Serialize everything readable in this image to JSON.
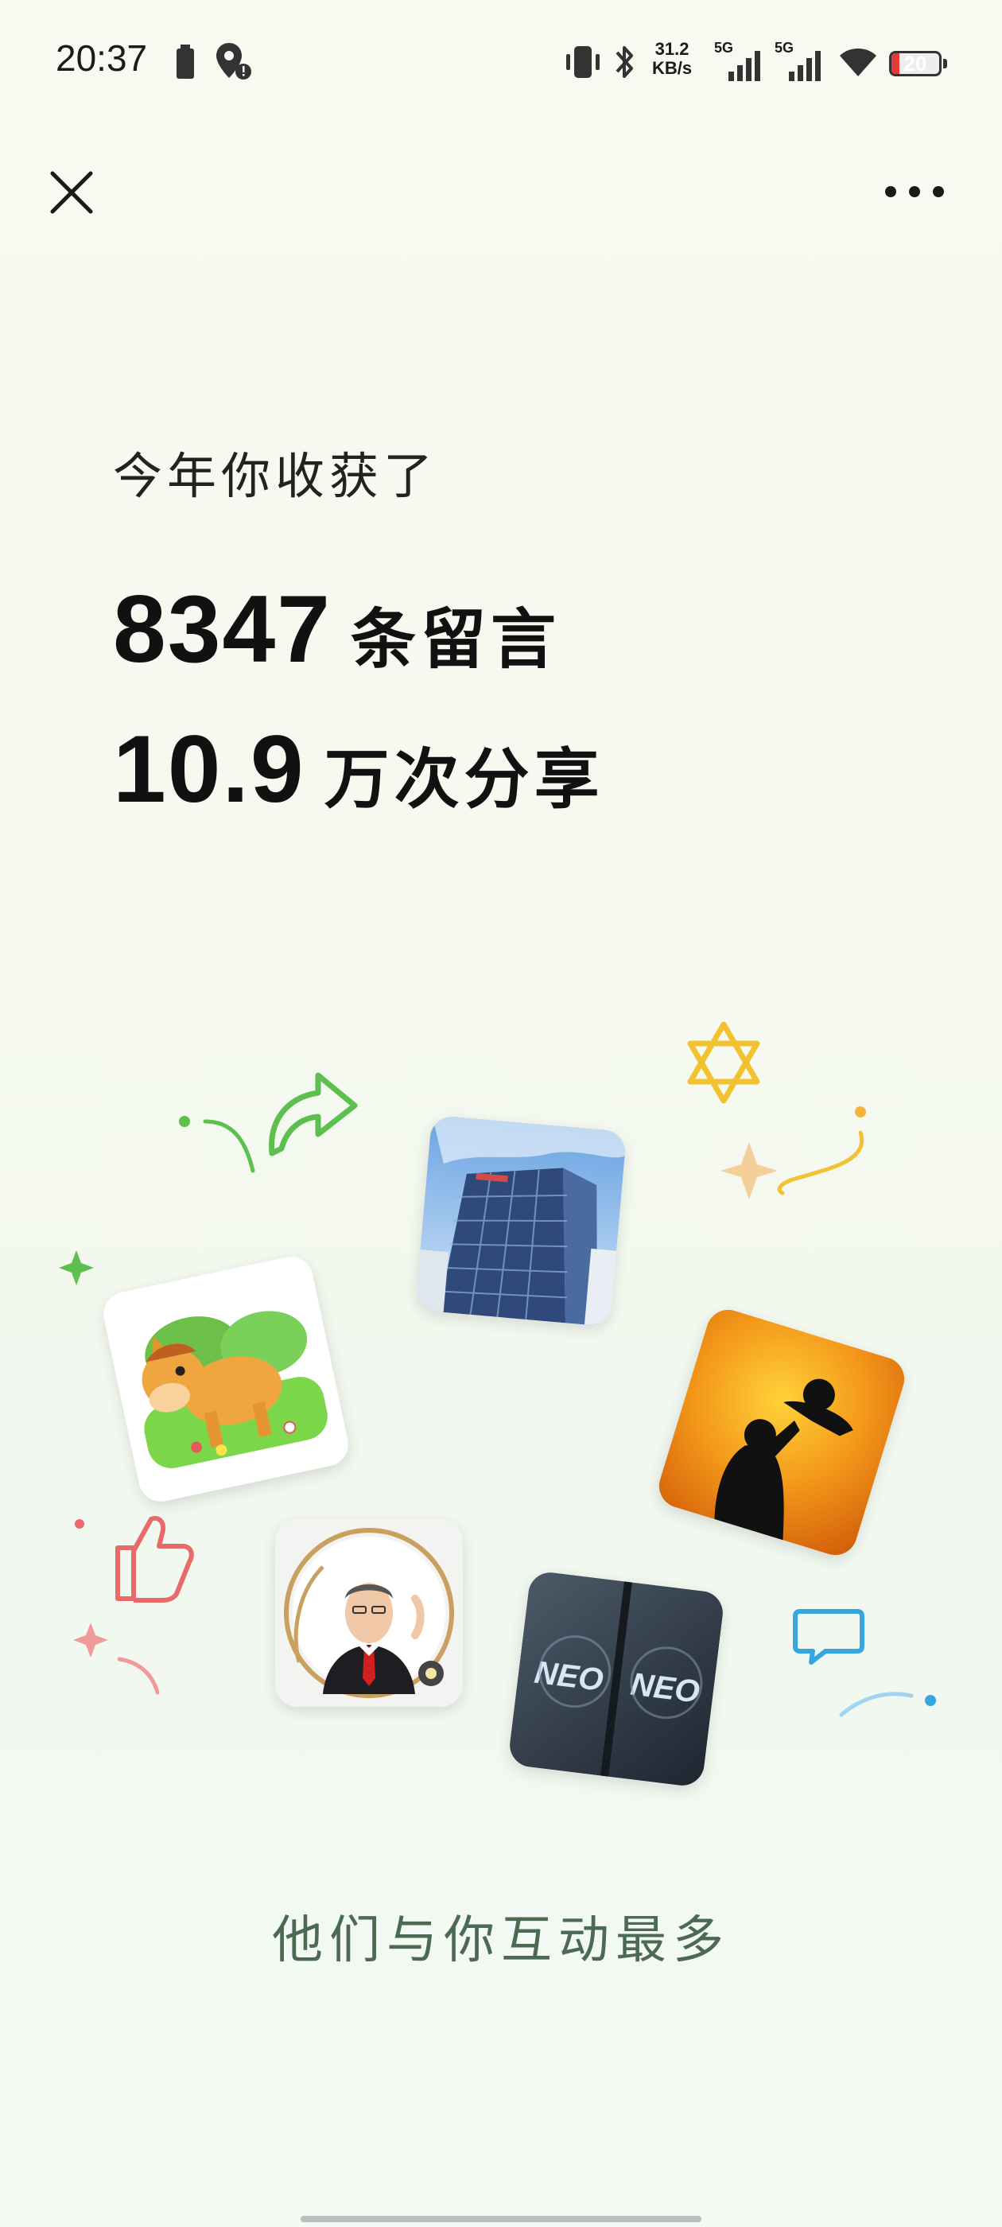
{
  "status_bar": {
    "time": "20:37",
    "net_speed_value": "31.2",
    "net_speed_unit": "KB/s",
    "signal_1_label": "5G",
    "signal_2_label": "5G",
    "battery": "20"
  },
  "summary": {
    "subtitle": "今年你收获了",
    "comments_count": "8347",
    "comments_label": "条留言",
    "shares_count": "10.9",
    "shares_label": "万次分享"
  },
  "avatars": [
    {
      "name": "avatar-building"
    },
    {
      "name": "avatar-pony"
    },
    {
      "name": "avatar-sunset"
    },
    {
      "name": "avatar-man-suit"
    },
    {
      "name": "avatar-neo-phone"
    }
  ],
  "avatar_labels": {
    "neo_left": "NEO",
    "neo_right": "NEO"
  },
  "footer": {
    "text": "他们与你互动最多"
  },
  "colors": {
    "background": "#f6f9ef",
    "accent_green": "#5cbf4e",
    "accent_yellow": "#f2c230",
    "accent_red": "#e96a6a",
    "accent_blue": "#36a6de",
    "footer_text": "#4c6a52"
  }
}
